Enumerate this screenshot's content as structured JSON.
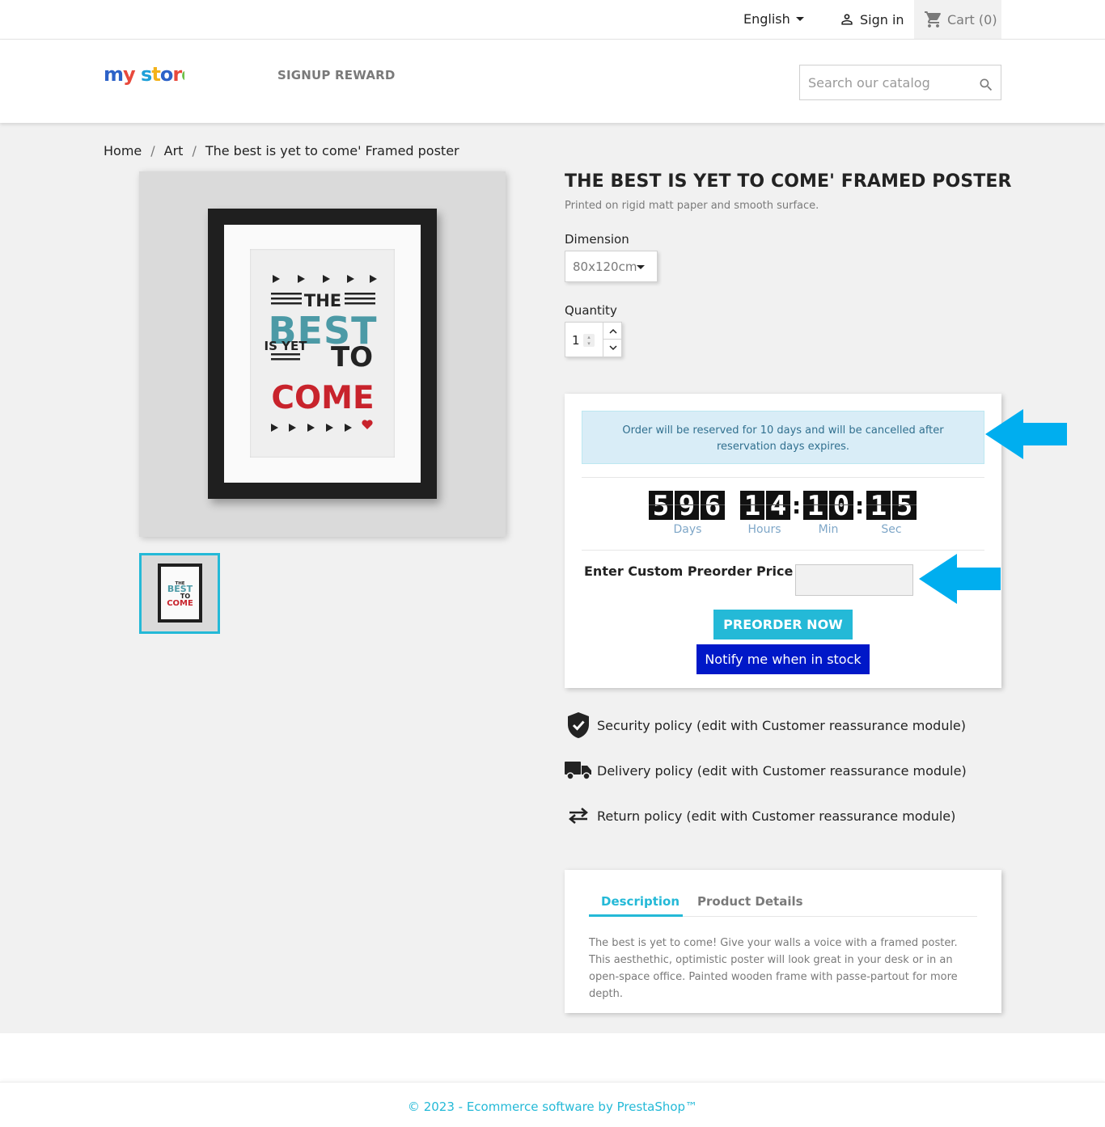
{
  "topbar": {
    "language": "English",
    "sign_in": "Sign in",
    "cart": "Cart (0)"
  },
  "header": {
    "logo_text": "my store",
    "nav_item": "SIGNUP REWARD",
    "search_placeholder": "Search our catalog"
  },
  "breadcrumb": [
    "Home",
    "Art",
    "The best is yet to come' Framed poster"
  ],
  "product": {
    "title": "THE BEST IS YET TO COME' FRAMED POSTER",
    "short_desc": "Printed on rigid matt paper and smooth surface.",
    "dimension_label": "Dimension",
    "dimension_value": "80x120cm",
    "quantity_label": "Quantity",
    "quantity_value": "1",
    "poster_lines": [
      "THE",
      "BEST",
      "IS YET",
      "TO",
      "COME"
    ]
  },
  "preorder": {
    "notice": "Order will be reserved for 10 days and will be cancelled after reservation days expires.",
    "countdown": {
      "days": "596",
      "hours": "14",
      "min": "10",
      "sec": "15",
      "labels": [
        "Days",
        "Hours",
        "Min",
        "Sec"
      ]
    },
    "custom_price_label": "Enter Custom Preorder Price",
    "custom_price_value": "",
    "preorder_button": "PREORDER NOW",
    "notify_button": "Notify me when in stock"
  },
  "reassurance": [
    {
      "icon": "shield-check-icon",
      "text": "Security policy (edit with Customer reassurance module)"
    },
    {
      "icon": "truck-icon",
      "text": "Delivery policy (edit with Customer reassurance module)"
    },
    {
      "icon": "swap-arrows-icon",
      "text": "Return policy (edit with Customer reassurance module)"
    }
  ],
  "tabs": {
    "items": [
      "Description",
      "Product Details"
    ],
    "active": "Description",
    "description": "The best is yet to come! Give your walls a voice with a framed poster. This aesthethic, optimistic poster will look great in your desk or in an open-space office. Painted wooden frame with passe-partout for more depth."
  },
  "footer": {
    "text": "© 2023 - Ecommerce software by PrestaShop™"
  },
  "colors": {
    "accent": "#24b9d7",
    "notify_button": "#0018c8",
    "arrow": "#00aeef",
    "alert_bg": "#d9edf7",
    "poster_teal": "#4c9aa6",
    "poster_red": "#c8232c"
  }
}
